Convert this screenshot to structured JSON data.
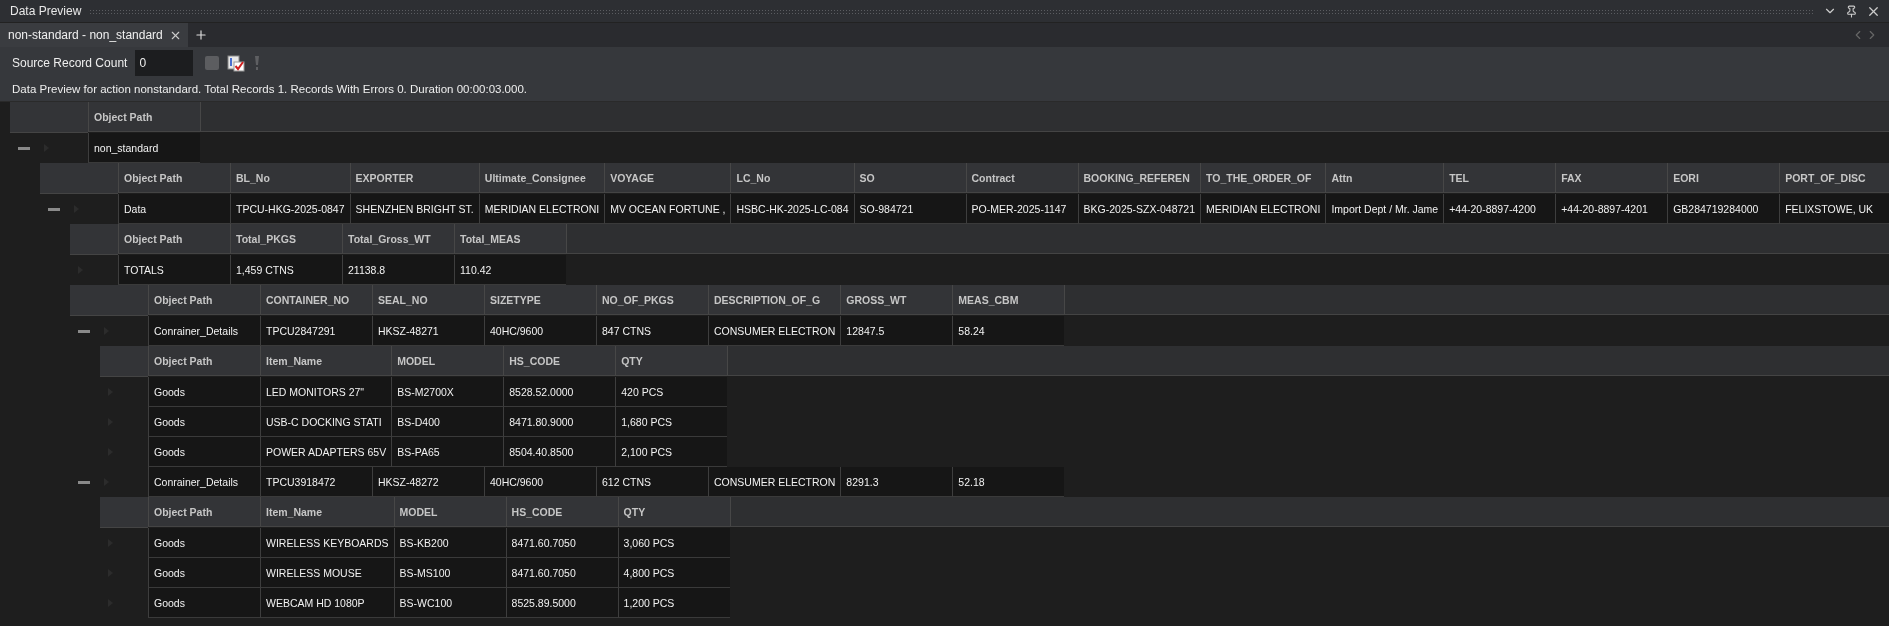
{
  "panel": {
    "title": "Data Preview"
  },
  "tabs": [
    {
      "label": "non-standard - non_standard",
      "selected": true
    }
  ],
  "toolbar": {
    "label": "Source Record Count",
    "value": "0"
  },
  "status": "Data Preview for action nonstandard. Total Records 1. Records With Errors 0. Duration 00:00:03.000.",
  "grid": {
    "columns": [
      "Object Path"
    ],
    "rows": [
      {
        "cells": [
          "non_standard"
        ],
        "expanded": true,
        "children": [
          {
            "columns": [
              "Object Path",
              "BL_No",
              "EXPORTER",
              "Ultimate_Consignee",
              "VOYAGE",
              "LC_No",
              "SO",
              "Contract",
              "BOOKING_REFEREN",
              "TO_THE_ORDER_OF",
              "Attn",
              "TEL",
              "FAX",
              "EORI",
              "PORT_OF_DISC"
            ],
            "rows": [
              {
                "cells": [
                  "Data",
                  "TPCU-HKG-2025-0847",
                  "SHENZHEN BRIGHT ST.",
                  "MERIDIAN ELECTRONI",
                  "MV OCEAN FORTUNE ,",
                  "HSBC-HK-2025-LC-084",
                  "SO-984721",
                  "PO-MER-2025-1147",
                  "BKG-2025-SZX-048721",
                  "MERIDIAN ELECTRONI",
                  "Import Dept / Mr. Jame",
                  "+44-20-8897-4200",
                  "+44-20-8897-4201",
                  "GB284719284000",
                  "FELIXSTOWE, UK"
                ],
                "expanded": true,
                "children": [
                  {
                    "columns": [
                      "Object Path",
                      "Total_PKGS",
                      "Total_Gross_WT",
                      "Total_MEAS"
                    ],
                    "rows": [
                      {
                        "cells": [
                          "TOTALS",
                          "1,459 CTNS",
                          "21138.8",
                          "110.42"
                        ]
                      }
                    ]
                  },
                  {
                    "columns": [
                      "Object Path",
                      "CONTAINER_NO",
                      "SEAL_NO",
                      "SIZETYPE",
                      "NO_OF_PKGS",
                      "DESCRIPTION_OF_G",
                      "GROSS_WT",
                      "MEAS_CBM"
                    ],
                    "rows": [
                      {
                        "cells": [
                          "Conrainer_Details",
                          "TPCU2847291",
                          "HKSZ-48271",
                          "40HC/9600",
                          "847 CTNS",
                          "CONSUMER ELECTRON",
                          "12847.5",
                          "58.24"
                        ],
                        "expanded": true,
                        "children": [
                          {
                            "columns": [
                              "Object Path",
                              "Item_Name",
                              "MODEL",
                              "HS_CODE",
                              "QTY"
                            ],
                            "rows": [
                              {
                                "cells": [
                                  "Goods",
                                  "LED MONITORS 27\"",
                                  "BS-M2700X",
                                  "8528.52.0000",
                                  "420 PCS"
                                ]
                              },
                              {
                                "cells": [
                                  "Goods",
                                  "USB-C DOCKING STATI",
                                  "BS-D400",
                                  "8471.80.9000",
                                  "1,680 PCS"
                                ]
                              },
                              {
                                "cells": [
                                  "Goods",
                                  "POWER ADAPTERS 65V",
                                  "BS-PA65",
                                  "8504.40.8500",
                                  "2,100 PCS"
                                ]
                              }
                            ]
                          }
                        ]
                      },
                      {
                        "cells": [
                          "Conrainer_Details",
                          "TPCU3918472",
                          "HKSZ-48272",
                          "40HC/9600",
                          "612 CTNS",
                          "CONSUMER ELECTRON",
                          "8291.3",
                          "52.18"
                        ],
                        "expanded": true,
                        "children": [
                          {
                            "columns": [
                              "Object Path",
                              "Item_Name",
                              "MODEL",
                              "HS_CODE",
                              "QTY"
                            ],
                            "rows": [
                              {
                                "cells": [
                                  "Goods",
                                  "WIRELESS KEYBOARDS",
                                  "BS-KB200",
                                  "8471.60.7050",
                                  "3,060 PCS"
                                ]
                              },
                              {
                                "cells": [
                                  "Goods",
                                  "WIRELESS MOUSE",
                                  "BS-MS100",
                                  "8471.60.7050",
                                  "4,800 PCS"
                                ]
                              },
                              {
                                "cells": [
                                  "Goods",
                                  "WEBCAM HD 1080P",
                                  "BS-WC100",
                                  "8525.89.5000",
                                  "1,200 PCS"
                                ]
                              }
                            ]
                          }
                        ]
                      }
                    ]
                  }
                ]
              }
            ]
          }
        ]
      }
    ]
  }
}
